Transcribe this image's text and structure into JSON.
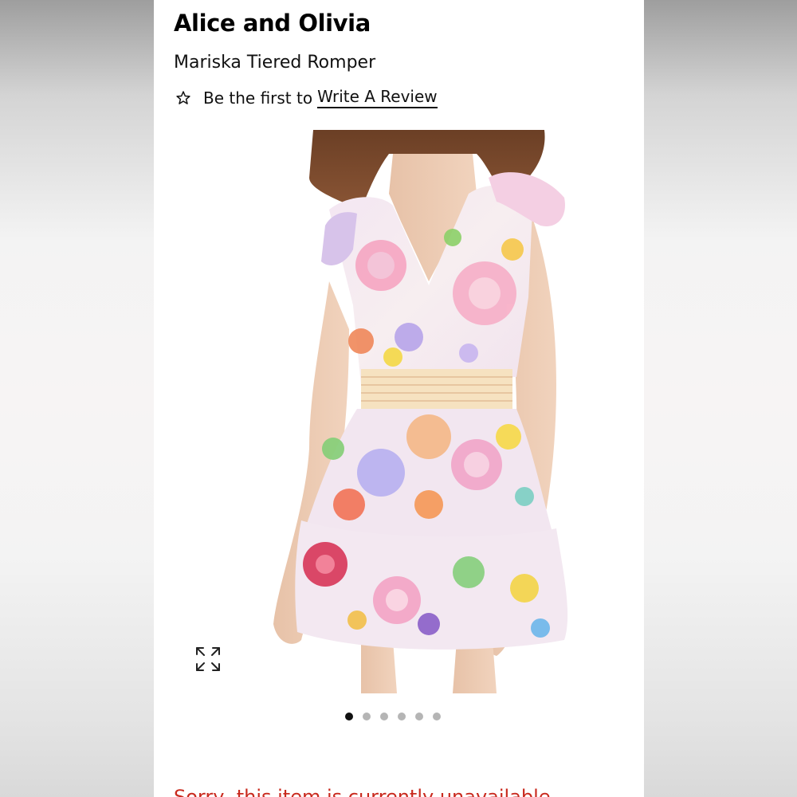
{
  "product": {
    "brand": "Alice and Olivia",
    "name": "Mariska Tiered Romper"
  },
  "reviews": {
    "prompt": "Be the first to",
    "link_label": "Write A Review"
  },
  "gallery": {
    "image_count": 6,
    "active_index": 0,
    "image_description": "model wearing floral print tiered romper"
  },
  "status": {
    "cutoff_text": "Sorry, this item is currently unavailable"
  },
  "colors": {
    "text": "#111111",
    "dot_active": "#111111",
    "dot_inactive": "#b5b5b5",
    "alert": "#c92a1e"
  },
  "icons": {
    "review": "star-outline-icon",
    "zoom": "expand-icon"
  }
}
